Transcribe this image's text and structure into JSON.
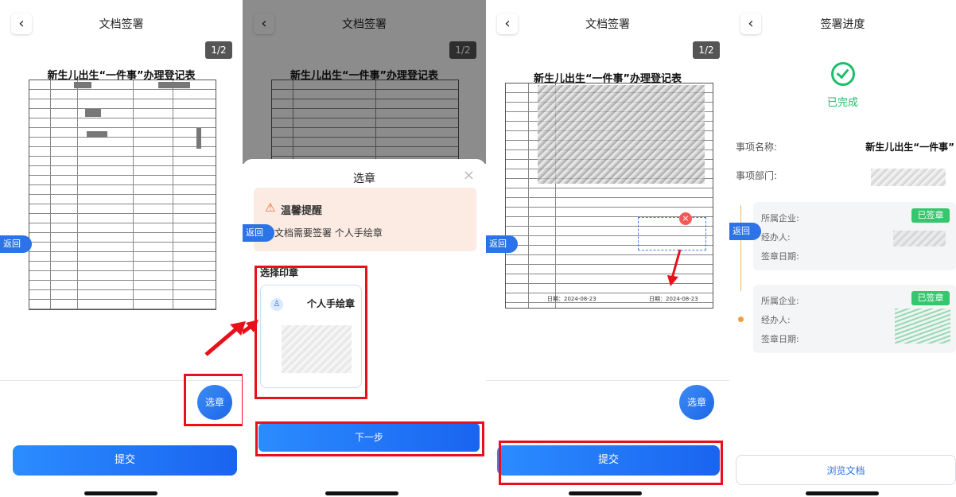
{
  "screens": {
    "s1": {
      "back_icon": "‹",
      "title": "文档签署",
      "page_indicator": "1/2",
      "doc_title": "新生儿出生“一件事”办理登记表",
      "return_label": "返回",
      "fab_label": "选章",
      "submit_label": "提交"
    },
    "s2": {
      "back_icon": "‹",
      "title": "文档签署",
      "page_indicator": "1/2",
      "doc_title": "新生儿出生“一件事”办理登记表",
      "return_label": "返回",
      "sheet_title": "选章",
      "close_icon": "×",
      "warning_icon": "⚠",
      "warning_title": "温馨提醒",
      "warning_text": "文档需要签署 个人手绘章",
      "select_label": "选择印章",
      "seal_icon": "♙",
      "seal_name": "个人手绘章",
      "next_label": "下一步"
    },
    "s3": {
      "back_icon": "‹",
      "title": "文档签署",
      "page_indicator": "1/2",
      "doc_title": "新生儿出生“一件事”办理登记表",
      "return_label": "返回",
      "fab_label": "选章",
      "submit_label": "提交",
      "remove_icon": "×",
      "date_left": "日期：2024-08-23",
      "date_right": "日期：2024-08-23"
    },
    "s4": {
      "back_icon": "‹",
      "title": "签署进度",
      "status_text": "已完成",
      "item_name_label": "事项名称:",
      "item_name_value": "新生儿出生“一件事”",
      "dept_label": "事项部门:",
      "return_label": "返回",
      "steps": [
        {
          "company_label": "所属企业:",
          "agent_label": "经办人:",
          "date_label": "签章日期:",
          "badge": "已签章"
        },
        {
          "company_label": "所属企业:",
          "agent_label": "经办人:",
          "date_label": "签章日期:",
          "badge": "已签章"
        }
      ],
      "browse_label": "浏览文档"
    }
  },
  "colors": {
    "primary": "#1a64f0",
    "annotation_red": "#e8101a",
    "success_green": "#1dbe6b",
    "warning_bg": "#fbebe3"
  }
}
